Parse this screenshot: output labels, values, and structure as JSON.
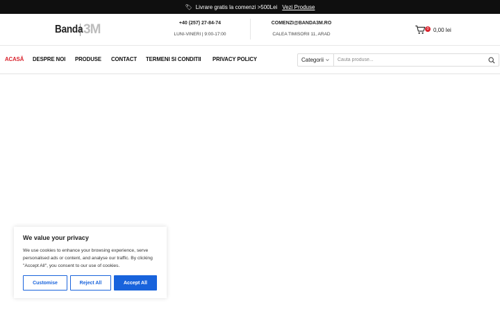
{
  "promo": {
    "icon": "tag-icon",
    "text": "Livrare gratis la comenzi >500Lei",
    "link": "Vezi Produse"
  },
  "header": {
    "logo": {
      "word": "Banda",
      "mark": "3M"
    },
    "phone": "+40 (257) 27-84-74",
    "hours": "LUNI-VINERI | 9:00-17:00",
    "email": "COMENZI@BANDA3M.RO",
    "address": "CALEA TIMISORII 11, ARAD",
    "cart": {
      "icon": "cart-icon",
      "count": "0",
      "total": "0,00 lei"
    }
  },
  "nav": {
    "items": [
      {
        "label": "Acasă",
        "active": true
      },
      {
        "label": "Despre noi"
      },
      {
        "label": "Produse"
      },
      {
        "label": "Contact"
      },
      {
        "label": "Termeni si conditii"
      },
      {
        "label": "Privacy Policy"
      }
    ]
  },
  "search": {
    "category": "Categorii",
    "placeholder": "Cauta produse...",
    "icon": "search-icon"
  },
  "cookie": {
    "title": "We value your privacy",
    "text": "We use cookies to enhance your browsing experience, serve personalised ads or content, and analyse our traffic. By clicking \"Accept All\", you consent to our use of cookies.",
    "customise": "Customise",
    "reject": "Reject All",
    "accept": "Accept All",
    "accent": "#1863dc"
  },
  "colors": {
    "accent_red": "#d9232d",
    "promo_bg": "#0f0f0f"
  }
}
